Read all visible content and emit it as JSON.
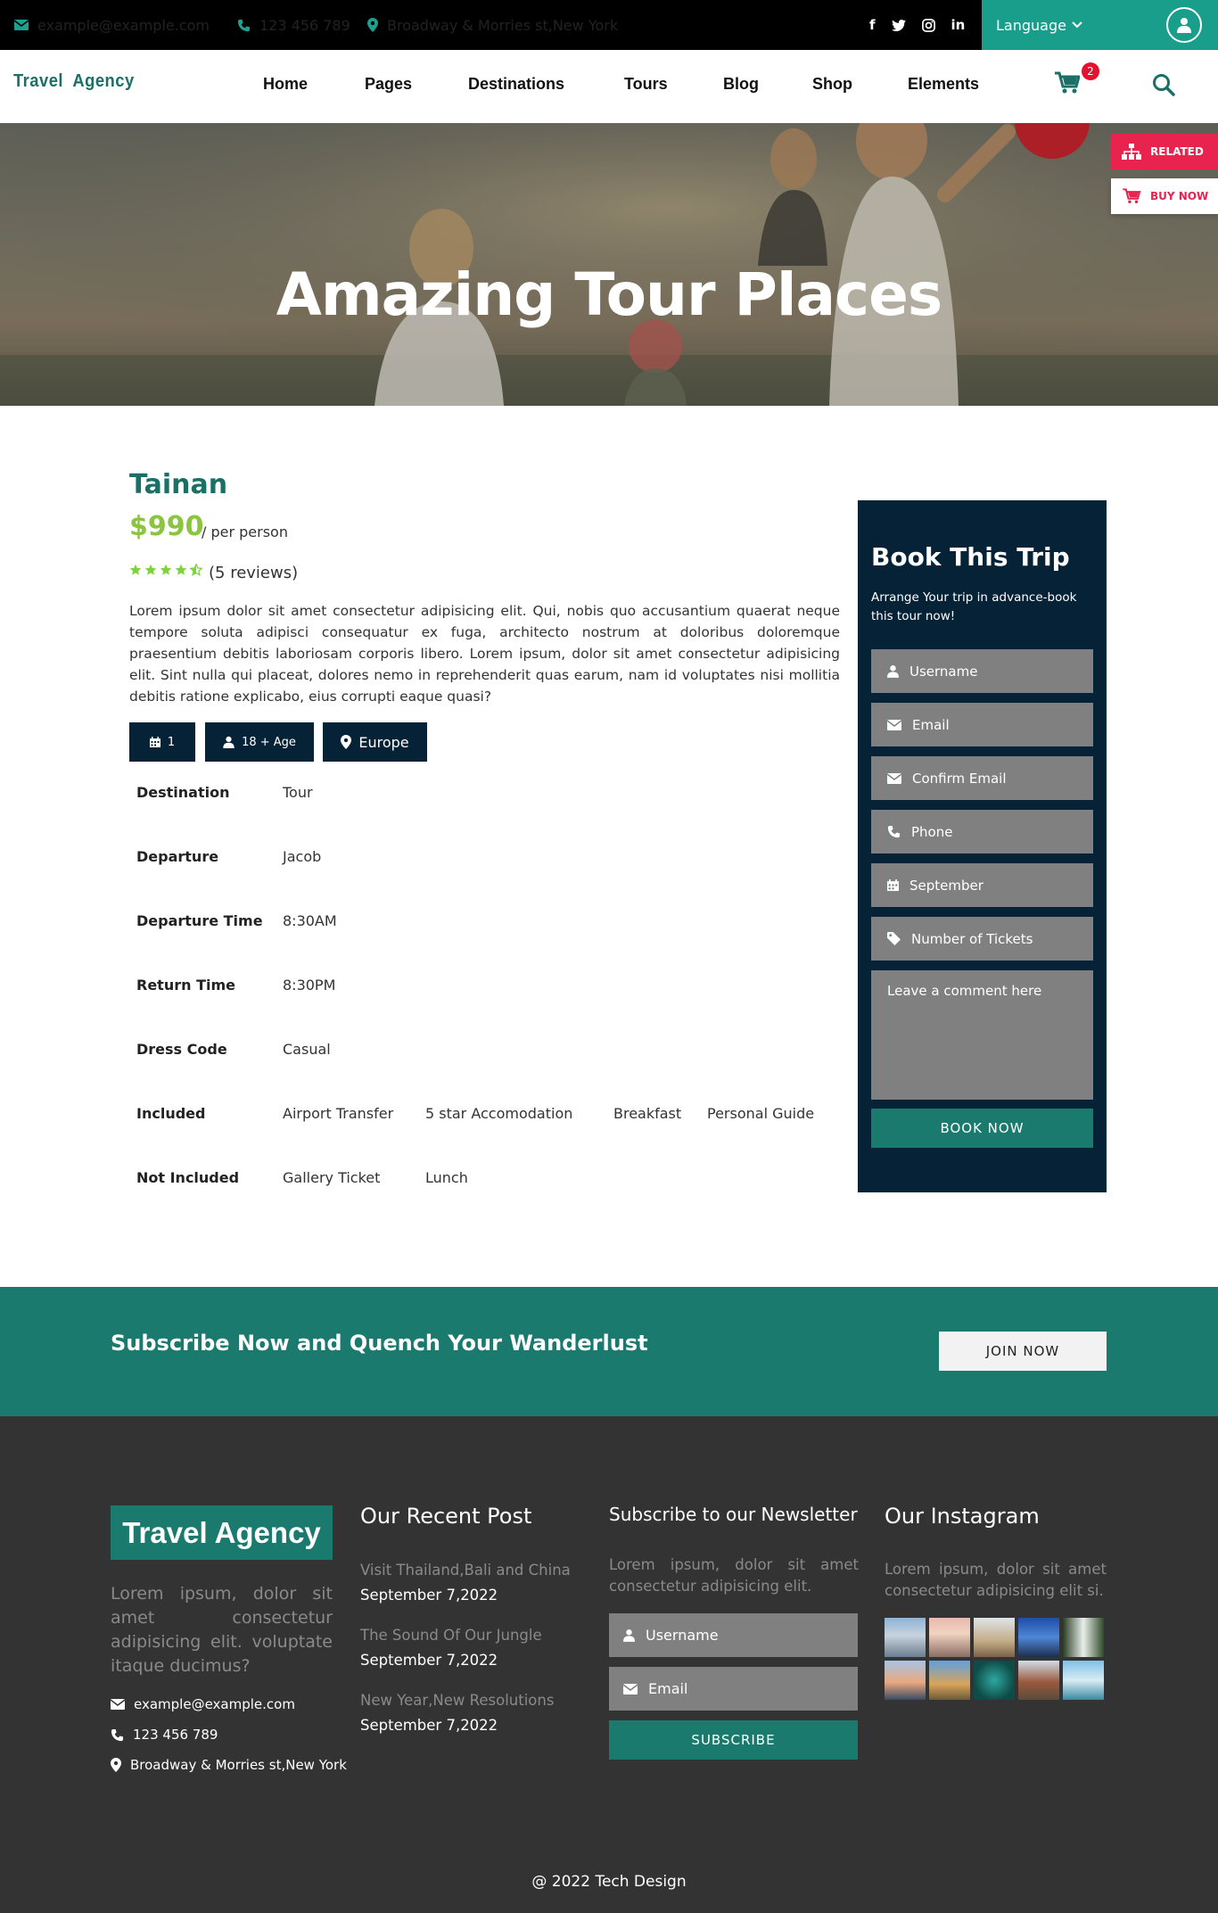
{
  "topbar": {
    "email": "example@example.com",
    "phone": "123 456 789",
    "address": "Broadway & Morries st,New York",
    "social": [
      "f",
      "t",
      "ig",
      "in"
    ],
    "language": "Language"
  },
  "nav": {
    "logo": "Travel  Agency",
    "items": [
      "Home",
      "Pages",
      "Destinations",
      "Tours",
      "Blog",
      "Shop",
      "Elements"
    ],
    "cart_count": "2"
  },
  "side_tabs": {
    "related": "RELATED",
    "buy_now": "BUY NOW"
  },
  "hero": {
    "title": "Amazing Tour Places"
  },
  "tour": {
    "name": "Tainan",
    "price": "$990",
    "per": "/ per person",
    "rating": 4.5,
    "reviews": "(5 reviews)",
    "description": "Lorem ipsum dolor sit amet consectetur adipisicing elit. Qui, nobis quo accusantium quaerat neque tempore soluta adipisci consequatur ex fuga, architecto nostrum at doloribus doloremque praesentium debitis laboriosam corporis libero. Lorem ipsum, dolor sit amet consectetur adipisicing elit. Sint nulla qui placeat, dolores nemo in reprehenderit quas earum, nam id voluptates nisi mollitia debitis ratione explicabo, eius corrupti eaque quasi?",
    "chips": {
      "days": "1",
      "age": "18 + Age",
      "region": "Europe"
    },
    "details": {
      "destination": {
        "label": "Destination",
        "values": [
          "Tour"
        ]
      },
      "departure": {
        "label": "Departure",
        "values": [
          "Jacob"
        ]
      },
      "departure_time": {
        "label": "Departure Time",
        "values": [
          "8:30AM"
        ]
      },
      "return_time": {
        "label": "Return Time",
        "values": [
          "8:30PM"
        ]
      },
      "dress_code": {
        "label": "Dress Code",
        "values": [
          "Casual"
        ]
      },
      "included": {
        "label": "Included",
        "values": [
          "Airport Transfer",
          "5 star Accomodation",
          "Breakfast",
          "Personal Guide"
        ]
      },
      "not_included": {
        "label": "Not Included",
        "values": [
          "Gallery Ticket",
          "Lunch"
        ]
      }
    }
  },
  "booking": {
    "title": "Book This Trip",
    "subtitle": "Arrange Your trip in advance-book this tour now!",
    "username": "Username",
    "email": "Email",
    "confirm_email": "Confirm Email",
    "phone": "Phone",
    "month": "September",
    "tickets": "Number of Tickets",
    "comment": "Leave a comment here",
    "button": "BOOK NOW"
  },
  "subscribe_band": {
    "text": "Subscribe Now and Quench Your Wanderlust",
    "button": "JOIN NOW"
  },
  "footer": {
    "logo": "Travel Agency",
    "about": "Lorem ipsum, dolor sit amet consectetur adipisicing elit. voluptate itaque ducimus?",
    "email": "example@example.com",
    "phone": "123 456 789",
    "address": "Broadway & Morries st,New York",
    "recent_title": "Our Recent Post",
    "posts": [
      {
        "title": "Visit Thailand,Bali and China",
        "date": "September 7,2022"
      },
      {
        "title": "The Sound Of Our Jungle",
        "date": "September 7,2022"
      },
      {
        "title": "New Year,New Resolutions",
        "date": "September 7,2022"
      }
    ],
    "newsletter_title": "Subscribe to our Newsletter",
    "newsletter_text": "Lorem ipsum, dolor sit amet consectetur adipisicing elit.",
    "nl_username": "Username",
    "nl_email": "Email",
    "nl_button": "SUBSCRIBE",
    "instagram_title": "Our Instagram",
    "instagram_text": "Lorem ipsum, dolor sit amet consectetur adipisicing elit si.",
    "copyright": "@ 2022 Tech Design"
  },
  "colors": {
    "teal": "#1a7a6e",
    "navy": "#062237",
    "green": "#8bc53f",
    "dark": "#333333",
    "pink": "#e8244e"
  }
}
